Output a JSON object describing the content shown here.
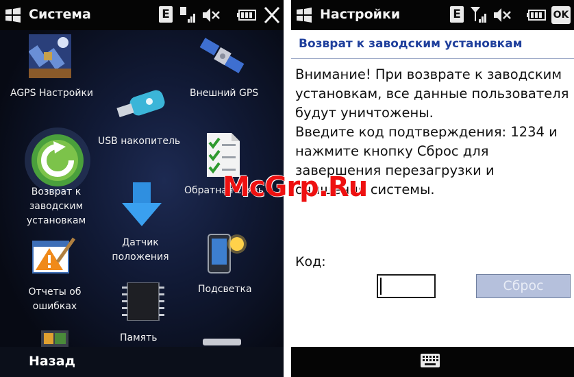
{
  "left_screen": {
    "title": "Система",
    "back_label": "Назад",
    "items": [
      {
        "label": "AGPS Настройки",
        "icon": "agps-satellite-icon"
      },
      {
        "label": "Внешний GPS",
        "icon": "satellite-icon"
      },
      {
        "label": "USB накопитель",
        "icon": "usb-drive-icon"
      },
      {
        "label_lines": [
          "Возврат к",
          "заводским",
          "установкам"
        ],
        "icon": "reset-arrow-icon"
      },
      {
        "label": "Обратная связь",
        "icon": "feedback-checklist-icon"
      },
      {
        "label_lines": [
          "Датчик",
          "положения"
        ],
        "icon": "down-arrow-icon"
      },
      {
        "label_lines": [
          "Отчеты об",
          "ошибках"
        ],
        "icon": "error-report-icon"
      },
      {
        "label": "Подсветка",
        "icon": "backlight-phone-icon"
      },
      {
        "label": "Память",
        "icon": "memory-chip-icon"
      }
    ]
  },
  "right_screen": {
    "title": "Настройки",
    "ok_label": "OK",
    "heading": "Возврат к заводским установкам",
    "message_lines": [
      "Внимание! При возврате к заводским",
      "установкам, все данные пользователя",
      "будут уничтожены.",
      "Введите код подтверждения: 1234 и",
      "нажмите кнопку Сброс для",
      "завершения перезагрузки и",
      "очищения системы."
    ],
    "code_label": "Код:",
    "code_value": "",
    "reset_label": "Сброс"
  },
  "watermark": "McGrp.Ru",
  "colors": {
    "heading_blue": "#1f3f9c",
    "watermark_red": "#ee1111",
    "disabled_button": "#b5c0dc"
  }
}
